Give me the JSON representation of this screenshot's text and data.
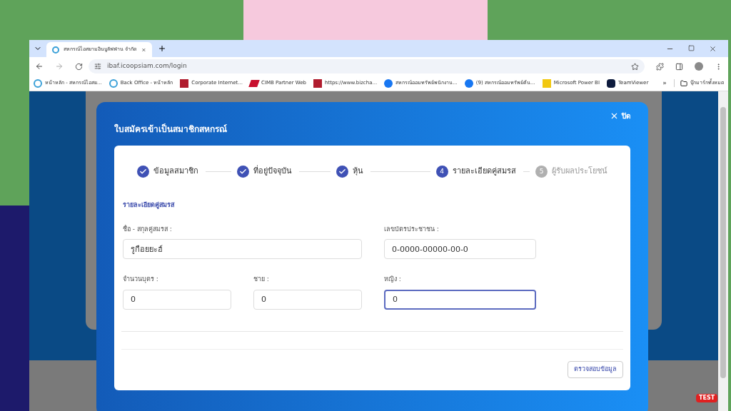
{
  "browser": {
    "tab": {
      "title": "สหกรณ์ไอสยามอินบูลัฟฟ่าน จำกัด",
      "selected": true
    },
    "url": "ibaf.icoopsiam.com/login",
    "bookmarks": [
      {
        "label": "หน้าหลัก - สหกรณ์ไอสย...",
        "kind": "coop"
      },
      {
        "label": "Back Office - หน้าหลัก",
        "kind": "coop"
      },
      {
        "label": "Corporate Internet...",
        "kind": "bank"
      },
      {
        "label": "CIMB Partner Web",
        "kind": "cimb"
      },
      {
        "label": "https://www.bizcha...",
        "kind": "bank"
      },
      {
        "label": "สหกรณ์ออมทรัพย์พนักงาน...",
        "kind": "facebook"
      },
      {
        "label": "(9) สหกรณ์ออมทรัพย์ต้น...",
        "kind": "facebook"
      },
      {
        "label": "Microsoft Power BI",
        "kind": "powerbi"
      },
      {
        "label": "TeamViewer",
        "kind": "teamviewer"
      }
    ],
    "more": "»",
    "all_bookmarks": "บุ๊กมาร์กทั้งหมด"
  },
  "modal": {
    "title": "ใบสมัครเข้าเป็นสมาชิกสหกรณ์",
    "close": "ปิด",
    "steps": [
      {
        "label": "ข้อมูลสมาชิก",
        "kind": "done"
      },
      {
        "label": "ที่อยู่ปัจจุบัน",
        "kind": "done"
      },
      {
        "label": "หุ้น",
        "kind": "done"
      },
      {
        "label": "รายละเอียดคู่สมรส",
        "number": "4",
        "kind": "current"
      },
      {
        "label": "ผู้รับผลประโยชน์",
        "number": "5",
        "kind": "pending"
      }
    ],
    "section": "รายละเอียดคู่สมรส",
    "fields": [
      {
        "label": "ชื่อ - สกุลคู่สมรส :",
        "value": "รูกือยยะฮ์",
        "focused": false
      },
      {
        "label": "เลขบัตรประชาชน :",
        "value": "0-0000-00000-00-0",
        "focused": false
      },
      {
        "label": "จำนวนบุตร :",
        "value": "0",
        "focused": false
      },
      {
        "label": "ชาย :",
        "value": "0",
        "focused": false
      },
      {
        "label": "หญิง :",
        "value": "0",
        "focused": true
      }
    ],
    "submit": "ตรวจสอบข้อมูล"
  },
  "badge": "TEST"
}
